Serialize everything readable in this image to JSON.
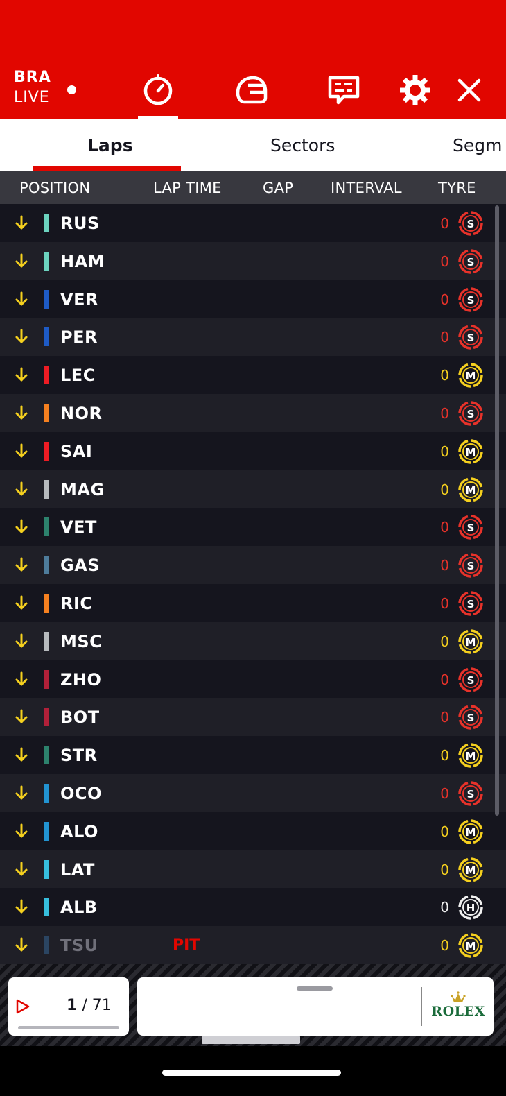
{
  "header": {
    "session_code": "BRA",
    "session_status": "LIVE",
    "icons": [
      "timer-icon",
      "helmet-icon",
      "race-control-messages-icon",
      "settings-icon",
      "close-icon"
    ]
  },
  "tabs": [
    {
      "label": "Laps",
      "active": true
    },
    {
      "label": "Sectors",
      "active": false
    },
    {
      "label": "Segm",
      "active": false
    }
  ],
  "columns": {
    "position": "POSITION",
    "lap_time": "LAP TIME",
    "gap": "GAP",
    "interval": "INTERVAL",
    "tyre": "TYRE"
  },
  "drivers": [
    {
      "code": "RUS",
      "team_color": "#6cd3bf",
      "laps": "0",
      "tyre": "S",
      "tyre_color": "#e8322a"
    },
    {
      "code": "HAM",
      "team_color": "#6cd3bf",
      "laps": "0",
      "tyre": "S",
      "tyre_color": "#e8322a"
    },
    {
      "code": "VER",
      "team_color": "#1e5bc6",
      "laps": "0",
      "tyre": "S",
      "tyre_color": "#e8322a"
    },
    {
      "code": "PER",
      "team_color": "#1e5bc6",
      "laps": "0",
      "tyre": "S",
      "tyre_color": "#e8322a"
    },
    {
      "code": "LEC",
      "team_color": "#ed1c24",
      "laps": "0",
      "tyre": "M",
      "tyre_color": "#f5d01e"
    },
    {
      "code": "NOR",
      "team_color": "#f58020",
      "laps": "0",
      "tyre": "S",
      "tyre_color": "#e8322a"
    },
    {
      "code": "SAI",
      "team_color": "#ed1c24",
      "laps": "0",
      "tyre": "M",
      "tyre_color": "#f5d01e"
    },
    {
      "code": "MAG",
      "team_color": "#b6babd",
      "laps": "0",
      "tyre": "M",
      "tyre_color": "#f5d01e"
    },
    {
      "code": "VET",
      "team_color": "#2d826d",
      "laps": "0",
      "tyre": "S",
      "tyre_color": "#e8322a"
    },
    {
      "code": "GAS",
      "team_color": "#4e7c9b",
      "laps": "0",
      "tyre": "S",
      "tyre_color": "#e8322a"
    },
    {
      "code": "RIC",
      "team_color": "#f58020",
      "laps": "0",
      "tyre": "S",
      "tyre_color": "#e8322a"
    },
    {
      "code": "MSC",
      "team_color": "#b6babd",
      "laps": "0",
      "tyre": "M",
      "tyre_color": "#f5d01e"
    },
    {
      "code": "ZHO",
      "team_color": "#b12039",
      "laps": "0",
      "tyre": "S",
      "tyre_color": "#e8322a"
    },
    {
      "code": "BOT",
      "team_color": "#b12039",
      "laps": "0",
      "tyre": "S",
      "tyre_color": "#e8322a"
    },
    {
      "code": "STR",
      "team_color": "#2d826d",
      "laps": "0",
      "tyre": "M",
      "tyre_color": "#f5d01e"
    },
    {
      "code": "OCO",
      "team_color": "#2293d1",
      "laps": "0",
      "tyre": "S",
      "tyre_color": "#e8322a"
    },
    {
      "code": "ALO",
      "team_color": "#2293d1",
      "laps": "0",
      "tyre": "M",
      "tyre_color": "#f5d01e"
    },
    {
      "code": "LAT",
      "team_color": "#37bedd",
      "laps": "0",
      "tyre": "M",
      "tyre_color": "#f5d01e"
    },
    {
      "code": "ALB",
      "team_color": "#37bedd",
      "laps": "0",
      "tyre": "H",
      "tyre_color": "#f0f0f0"
    },
    {
      "code": "TSU",
      "team_color": "#2b4562",
      "laps": "0",
      "tyre": "M",
      "tyre_color": "#f5d01e",
      "status": "PIT",
      "dim": true
    }
  ],
  "footer": {
    "current_lap": "1",
    "lap_separator": "/",
    "total_laps": "71",
    "sponsor": "ROLEX"
  },
  "colors": {
    "brand_red": "#e10600",
    "arrow_yellow": "#f5d01e",
    "row_dark": "#15151e",
    "row_alt": "#1f1f27",
    "header_row": "#38383f"
  }
}
